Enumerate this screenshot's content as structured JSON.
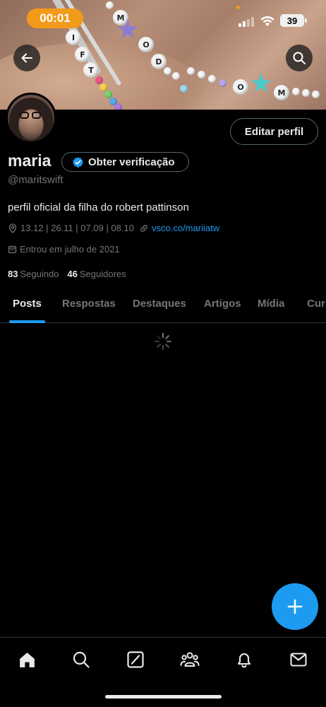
{
  "status_bar": {
    "time": "00:01",
    "battery": "39",
    "accent": "#f29a1a"
  },
  "banner": {
    "back_icon": "arrow-left-icon",
    "search_icon": "search-icon",
    "bead_letters_top": [
      "M",
      "I",
      "F",
      "T",
      "O",
      "D"
    ],
    "bead_letters_bottom": [
      "O",
      "M"
    ]
  },
  "profile": {
    "edit_label": "Editar perfil",
    "name": "maria",
    "verify_label": "Obter verificação",
    "handle": "@maritswift",
    "bio": "perfil oficial da filha do robert pattinson",
    "location": "13.12 | 26.11 | 07.09 | 08.10",
    "link": "vsco.co/mariiatw",
    "joined": "Entrou em julho de 2021",
    "following_count": "83",
    "following_label": "Seguindo",
    "followers_count": "46",
    "followers_label": "Seguidores"
  },
  "tabs": [
    {
      "label": "Posts",
      "active": true
    },
    {
      "label": "Respostas",
      "active": false
    },
    {
      "label": "Destaques",
      "active": false
    },
    {
      "label": "Artigos",
      "active": false
    },
    {
      "label": "Mídia",
      "active": false
    },
    {
      "label": "Cur",
      "active": false
    }
  ],
  "fab": {
    "icon": "plus-icon"
  },
  "bottom_nav": [
    {
      "icon": "home-icon"
    },
    {
      "icon": "search-icon"
    },
    {
      "icon": "grok-icon"
    },
    {
      "icon": "communities-icon"
    },
    {
      "icon": "notifications-icon"
    },
    {
      "icon": "messages-icon"
    }
  ],
  "colors": {
    "accent": "#1d9bf0",
    "background": "#000000",
    "text": "#e7e9ea",
    "muted": "#71767b",
    "border": "#2f3336"
  }
}
